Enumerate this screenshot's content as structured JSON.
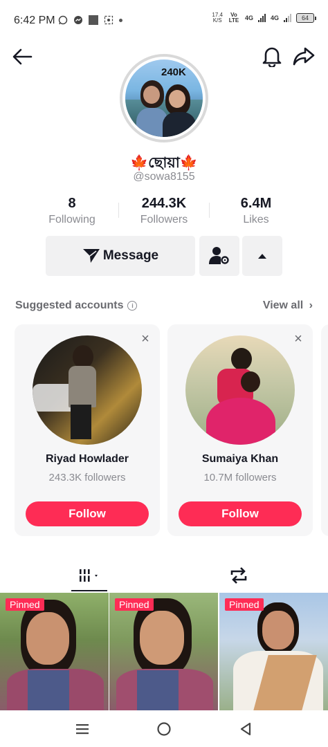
{
  "status_bar": {
    "time": "6:42 PM",
    "net_speed_value": "17.4",
    "net_speed_unit": "K/S",
    "volte": "Vo LTE",
    "signal1": "4G",
    "signal2": "4G",
    "battery": "64"
  },
  "profile": {
    "avatar_badge": "240K",
    "display_name": "🍁ছোয়া🍁",
    "username": "@sowa8155"
  },
  "stats": [
    {
      "value": "8",
      "label": "Following"
    },
    {
      "value": "244.3K",
      "label": "Followers"
    },
    {
      "value": "6.4M",
      "label": "Likes"
    }
  ],
  "actions": {
    "message_label": "Message"
  },
  "suggested": {
    "title": "Suggested accounts",
    "view_all": "View all",
    "close_glyph": "×",
    "cards": [
      {
        "name": "Riyad Howlader",
        "followers": "243.3K followers",
        "follow_label": "Follow"
      },
      {
        "name": "Sumaiya Khan",
        "followers": "10.7M followers",
        "follow_label": "Follow"
      }
    ]
  },
  "videos": {
    "pinned_label": "Pinned",
    "items": [
      {
        "pinned": true
      },
      {
        "pinned": true
      },
      {
        "pinned": true
      }
    ]
  },
  "icons": {
    "back": "arrow-left-icon",
    "bell": "bell-icon",
    "share": "share-icon",
    "message": "send-icon",
    "user_settings": "user-gear-icon",
    "expand": "triangle-up-icon",
    "info": "info-icon",
    "grid_tab": "grid-icon",
    "repost_tab": "repost-icon"
  },
  "colors": {
    "accent": "#fe2c55",
    "text": "#161823",
    "muted": "#8a8b91",
    "button_bg": "#f1f1f2"
  }
}
